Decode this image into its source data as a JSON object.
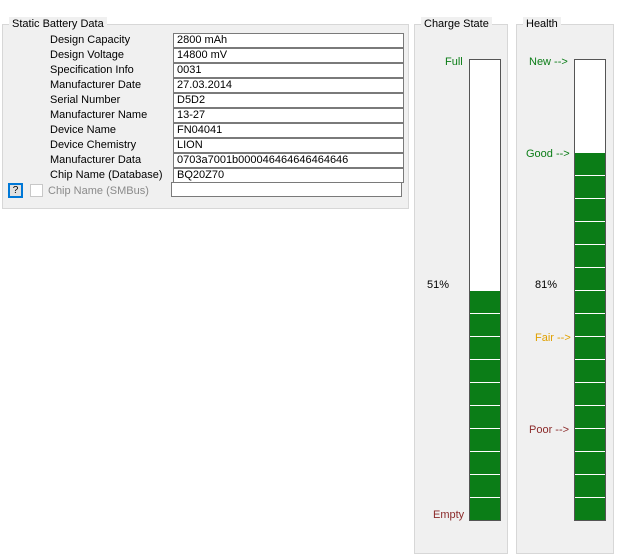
{
  "static_battery": {
    "title": "Static Battery Data",
    "rows": [
      {
        "label": "Design Capacity",
        "value": "2800 mAh"
      },
      {
        "label": "Design Voltage",
        "value": "14800 mV"
      },
      {
        "label": "Specification Info",
        "value": "0031"
      },
      {
        "label": "Manufacturer Date",
        "value": "27.03.2014"
      },
      {
        "label": "Serial Number",
        "value": "D5D2"
      },
      {
        "label": "Manufacturer Name",
        "value": "13-27"
      },
      {
        "label": "Device Name",
        "value": "FN04041"
      },
      {
        "label": "Device Chemistry",
        "value": "LION"
      },
      {
        "label": "Manufacturer Data",
        "value": "0703a7001b000046464646464646"
      },
      {
        "label": "Chip Name (Database)",
        "value": "BQ20Z70"
      }
    ],
    "help_button": "?",
    "chip_smbus_label": "Chip Name (SMBus)",
    "chip_smbus_value": ""
  },
  "charge_state": {
    "title": "Charge State",
    "full_label": "Full",
    "empty_label": "Empty",
    "percent_label": "51%",
    "level": 0.51,
    "colors": {
      "full": "#0b7d17",
      "empty": "#8b2a2a",
      "bar": "#0b7d17"
    }
  },
  "health": {
    "title": "Health",
    "new_label": "New -->",
    "good_label": "Good -->",
    "fair_label": "Fair -->",
    "poor_label": "Poor -->",
    "percent_label": "81%",
    "level": 0.81,
    "colors": {
      "new": "#0b7d17",
      "good": "#0b7d17",
      "fair": "#e0a000",
      "poor": "#8b2a2a",
      "bar": "#0b7d17"
    }
  }
}
